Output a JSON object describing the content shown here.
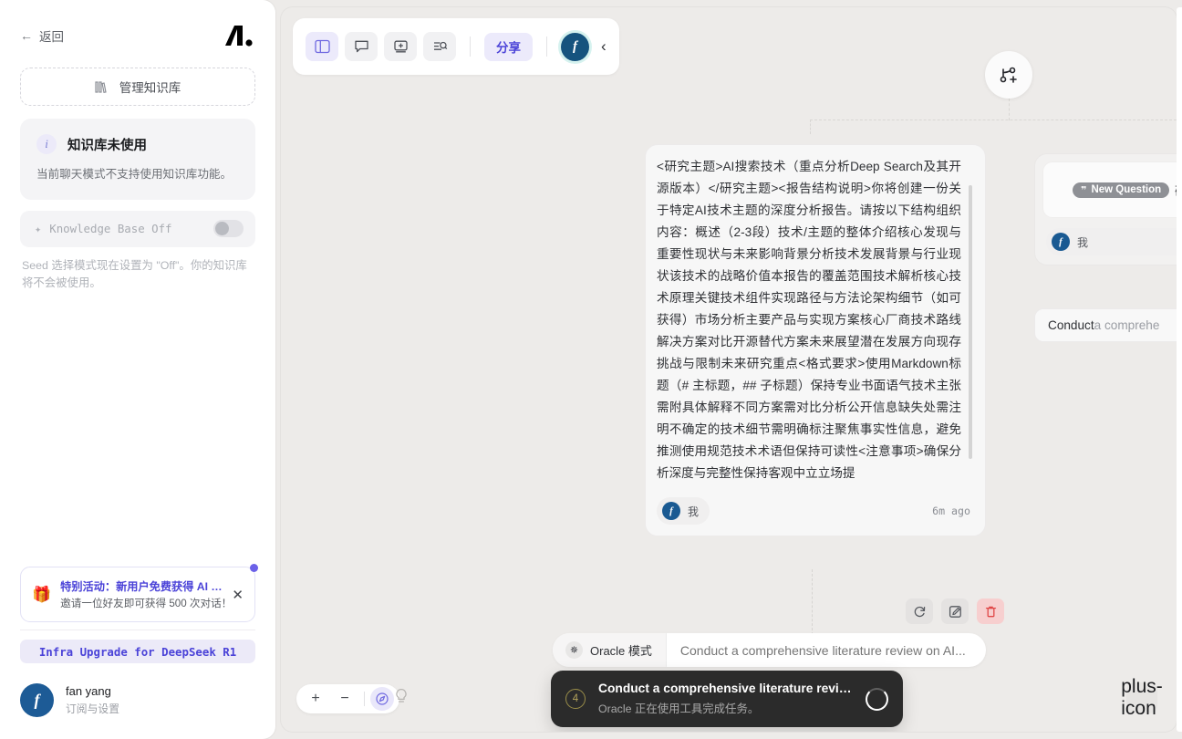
{
  "sidebar": {
    "back_label": "返回",
    "back_icon": "arrow-left-icon",
    "logo_alt": "brand-logo",
    "manage_button": {
      "label": "管理知识库",
      "icon": "library-books-icon"
    },
    "kb_card": {
      "icon": "info-circle-icon",
      "title": "知识库未使用",
      "subtitle": "当前聊天模式不支持使用知识库功能。"
    },
    "kb_toggle": {
      "icon": "sparkle-icon",
      "label": "Knowledge Base Off",
      "state": "off"
    },
    "kb_note": "Seed 选择模式现在设置为 \"Off\"。你的知识库将不会被使用。",
    "promo": {
      "icon": "gift-icon",
      "title": "特别活动：新用户免费获得 AI …",
      "subtitle": "邀请一位好友即可获得 500 次对话！",
      "close_icon": "close-icon"
    },
    "infra_button": "Infra Upgrade for DeepSeek R1",
    "user": {
      "avatar_initial": "f",
      "name": "fan yang",
      "subtitle": "订阅与设置"
    }
  },
  "toolbar": {
    "buttons": [
      {
        "name": "sidebar-panel-icon",
        "active": true
      },
      {
        "name": "chat-bubble-icon",
        "active": false
      },
      {
        "name": "add-card-icon",
        "active": false
      },
      {
        "name": "list-search-icon",
        "active": false
      }
    ],
    "share_label": "分享",
    "avatar_initial": "f",
    "collapse_icon": "chevron-left-icon"
  },
  "canvas": {
    "branch_node_icon": "git-branch-plus-icon",
    "message": {
      "text": "<研究主题>AI搜索技术（重点分析Deep Search及其开源版本）</研究主题><报告结构说明>你将创建一份关于特定AI技术主题的深度分析报告。请按以下结构组织内容：概述（2-3段）技术/主题的整体介绍核心发现与重要性现状与未来影响背景分析技术发展背景与行业现状该技术的战略价值本报告的覆盖范围技术解析核心技术原理关键技术组件实现路径与方法论架构细节（如可获得）市场分析主要产品与实现方案核心厂商技术路线解决方案对比开源替代方案未来展望潜在发展方向现存挑战与限制未来研究重点<格式要求>使用Markdown标题（# 主标题，## 子标题）保持专业书面语气技术主张需附具体解释不同方案需对比分析公开信息缺失处需注明不确定的技术细节需明确标注聚焦事实性信息，避免推测使用规范技术术语但保持可读性<注意事项>确保分析深度与完整性保持客观中立立场提",
      "author_avatar": "f",
      "author_label": "我",
      "timestamp": "6m ago"
    },
    "actions": [
      {
        "name": "regenerate-button",
        "icon": "refresh-icon"
      },
      {
        "name": "edit-button",
        "icon": "pencil-square-icon"
      },
      {
        "name": "delete-button",
        "icon": "trash-icon"
      }
    ],
    "side_card": {
      "badge_label": "New Question",
      "badge_icon": "quote-icon",
      "tail_text": "研",
      "author_avatar": "f",
      "author_label": "我"
    },
    "side_card2": {
      "text_bold": "Conduct",
      "text_rest": " a comprehe"
    }
  },
  "composer": {
    "mode_icon": "sparkles-icon",
    "mode_label": "Oracle 模式",
    "input_value": "",
    "input_placeholder": "Conduct a comprehensive literature review on AI..."
  },
  "toast": {
    "step_number": "4",
    "title": "Conduct a comprehensive literature review...",
    "subtitle": "Oracle 正在使用工具完成任务。",
    "spinner": "loading-spinner-icon"
  },
  "zoom_controls": {
    "zoom_in": "+",
    "zoom_out": "−",
    "fit_icon": "compass-navigate-icon",
    "hint_icon": "lightbulb-icon"
  },
  "fab": {
    "icon": "plus-icon"
  }
}
